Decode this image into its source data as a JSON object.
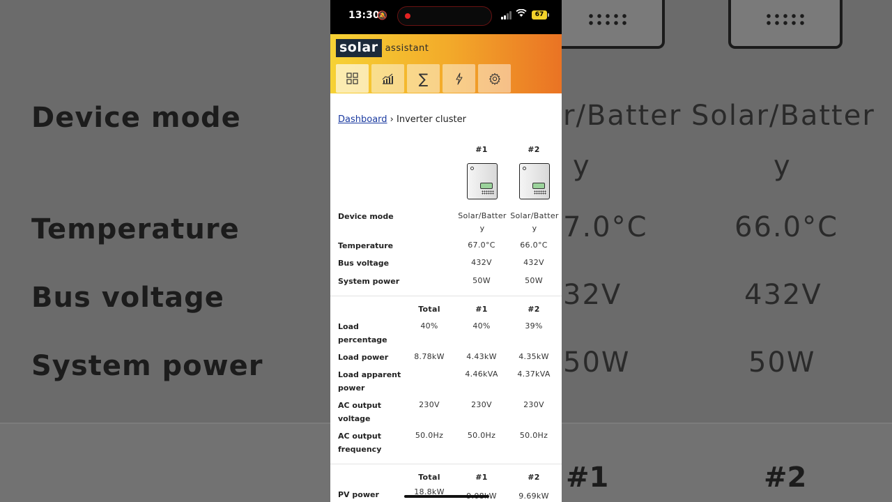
{
  "statusbar": {
    "time": "13:30",
    "battery": "67"
  },
  "app": {
    "logo_primary": "solar",
    "logo_secondary": "assistant",
    "nav": [
      {
        "icon": "dashboard-grid-icon",
        "glyph": "▦"
      },
      {
        "icon": "chart-icon",
        "glyph": "📈"
      },
      {
        "icon": "sigma-icon",
        "glyph": "∑"
      },
      {
        "icon": "lightning-icon",
        "glyph": "ϟ"
      },
      {
        "icon": "gear-icon",
        "glyph": "⚙"
      }
    ]
  },
  "breadcrumb": {
    "link": "Dashboard",
    "separator": "›",
    "current": "Inverter cluster"
  },
  "devices_section": {
    "headers": [
      "#1",
      "#2"
    ],
    "rows": [
      {
        "label": "Device mode",
        "values": [
          "Solar/Batter y",
          "Solar/Batter y"
        ]
      },
      {
        "label": "Temperature",
        "values": [
          "67.0°C",
          "66.0°C"
        ]
      },
      {
        "label": "Bus voltage",
        "values": [
          "432V",
          "432V"
        ]
      },
      {
        "label": "System power",
        "values": [
          "50W",
          "50W"
        ]
      }
    ]
  },
  "load_section": {
    "headers": [
      "Total",
      "#1",
      "#2"
    ],
    "rows": [
      {
        "label": "Load percentage",
        "values": [
          "40%",
          "40%",
          "39%"
        ]
      },
      {
        "label": "Load power",
        "values": [
          "8.78kW",
          "4.43kW",
          "4.35kW"
        ]
      },
      {
        "label": "Load apparent power",
        "values": [
          "",
          "4.46kVA",
          "4.37kVA"
        ]
      },
      {
        "label": "AC output voltage",
        "values": [
          "230V",
          "230V",
          "230V"
        ]
      },
      {
        "label": "AC output frequency",
        "values": [
          "50.0Hz",
          "50.0Hz",
          "50.0Hz"
        ]
      }
    ]
  },
  "pv_section": {
    "headers": [
      "Total",
      "#1",
      "#2"
    ],
    "rows": [
      {
        "label": "PV power",
        "values": [
          "18.8kW",
          "9.08kW",
          "9.69kW"
        ]
      }
    ]
  },
  "background": {
    "labels": [
      "Device mode",
      "Temperature",
      "Bus voltage",
      "System power"
    ],
    "col1": [
      "r/Batter",
      "y",
      "7.0°C",
      "32V",
      "50W"
    ],
    "col2": [
      "Solar/Batter",
      "y",
      "66.0°C",
      "432V",
      "50W"
    ],
    "headers": [
      "#1",
      "#2"
    ]
  }
}
